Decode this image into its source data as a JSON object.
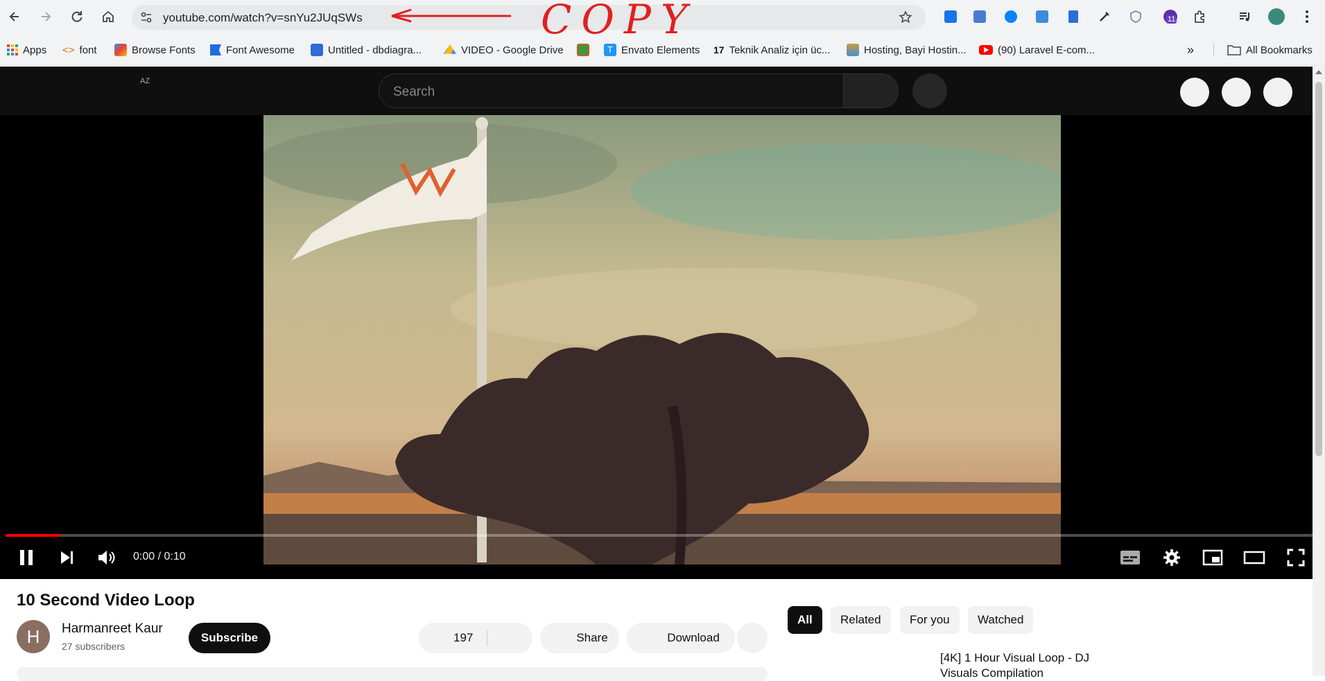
{
  "browser": {
    "url": "youtube.com/watch?v=snYu2JUqSWs",
    "annotation_text": "COPY",
    "extension_badge": "11",
    "bookmarks": [
      {
        "label": "Apps"
      },
      {
        "label": "font"
      },
      {
        "label": "Browse Fonts"
      },
      {
        "label": "Font Awesome"
      },
      {
        "label": "Untitled - dbdiagra..."
      },
      {
        "label": "VIDEO - Google Drive"
      },
      {
        "label": ""
      },
      {
        "label": "Envato Elements"
      },
      {
        "label": "Teknik Analiz için üc..."
      },
      {
        "label": "Hosting, Bayi Hostin..."
      },
      {
        "label": "(90) Laravel E-com..."
      }
    ],
    "overflow_label": "»",
    "all_bookmarks": "All Bookmarks"
  },
  "youtube": {
    "logo_region_label": "AZ",
    "search_placeholder": "Search",
    "player": {
      "time": "0:00 / 0:10",
      "progress": 0.042
    },
    "video": {
      "title": "10 Second Video Loop",
      "avatar_letter": "H",
      "channel": "Harmanreet Kaur",
      "subscribers": "27 subscribers",
      "subscribe_label": "Subscribe",
      "likes": "197",
      "share_label": "Share",
      "download_label": "Download"
    },
    "chips": [
      "All",
      "Related",
      "For you",
      "Watched"
    ],
    "recommendation_title": "[4K] 1 Hour Visual Loop - DJ Visuals Compilation"
  },
  "colors": {
    "accent_red": "#ff0000",
    "yt_dark": "#0f0f0f"
  }
}
